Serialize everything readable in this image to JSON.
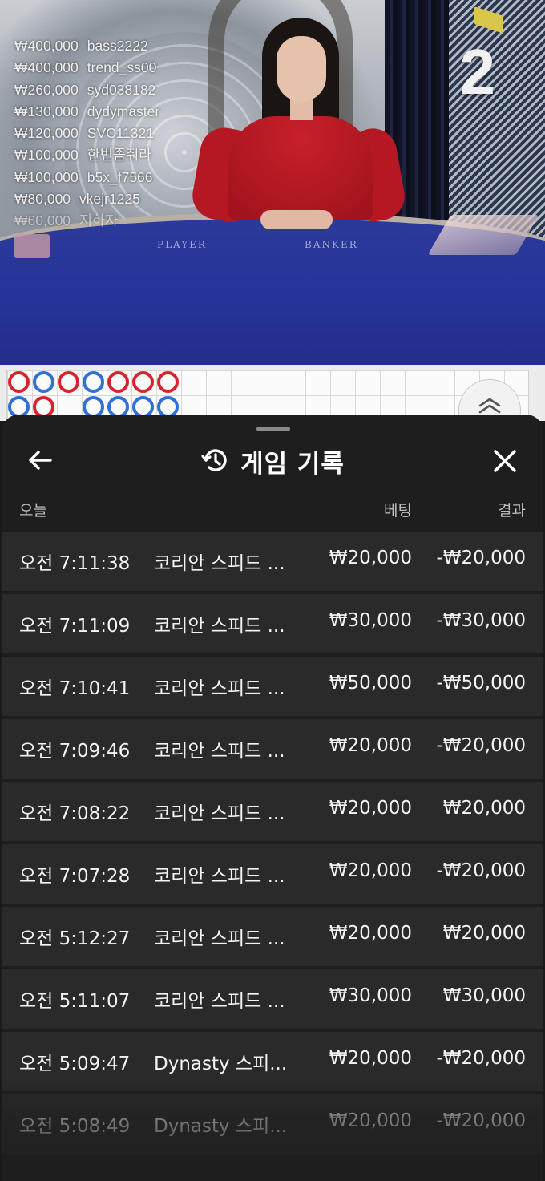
{
  "stream": {
    "table_labels": {
      "player": "PLAYER",
      "banker": "BANKER"
    },
    "round_number": "2",
    "winners": [
      {
        "amount": "₩400,000",
        "user": "bass2222"
      },
      {
        "amount": "₩400,000",
        "user": "trend_ss00"
      },
      {
        "amount": "₩260,000",
        "user": "syd038182"
      },
      {
        "amount": "₩130,000",
        "user": "dydymaster"
      },
      {
        "amount": "₩120,000",
        "user": "SVC11321"
      },
      {
        "amount": "₩100,000",
        "user": "한번좀줘라"
      },
      {
        "amount": "₩100,000",
        "user": "b5x_f7566"
      },
      {
        "amount": "₩80,000",
        "user": "vkejr1225"
      },
      {
        "amount": "₩60,000",
        "user": "지하자"
      }
    ]
  },
  "roadmap": {
    "beads": [
      "red",
      "blue",
      "blue",
      "red",
      "red",
      "blue",
      "blue",
      "red",
      "blue",
      "red",
      "blue",
      "red",
      "blue"
    ]
  },
  "history": {
    "title": "게임 기록",
    "icons": {
      "back": "arrow-left-icon",
      "title": "history-clock-icon",
      "close": "close-icon"
    },
    "columns": {
      "date": "오늘",
      "bet": "베팅",
      "result": "결과"
    },
    "rows": [
      {
        "time": "오전 7:11:38",
        "game": "코리안 스피드 ...",
        "bet": "₩20,000",
        "result": "-₩20,000"
      },
      {
        "time": "오전 7:11:09",
        "game": "코리안 스피드 ...",
        "bet": "₩30,000",
        "result": "-₩30,000"
      },
      {
        "time": "오전 7:10:41",
        "game": "코리안 스피드 ...",
        "bet": "₩50,000",
        "result": "-₩50,000"
      },
      {
        "time": "오전 7:09:46",
        "game": "코리안 스피드 ...",
        "bet": "₩20,000",
        "result": "-₩20,000"
      },
      {
        "time": "오전 7:08:22",
        "game": "코리안 스피드 ...",
        "bet": "₩20,000",
        "result": "₩20,000"
      },
      {
        "time": "오전 7:07:28",
        "game": "코리안 스피드 ...",
        "bet": "₩20,000",
        "result": "-₩20,000"
      },
      {
        "time": "오전 5:12:27",
        "game": "코리안 스피드 ...",
        "bet": "₩20,000",
        "result": "₩20,000"
      },
      {
        "time": "오전 5:11:07",
        "game": "코리안 스피드 ...",
        "bet": "₩30,000",
        "result": "₩30,000"
      },
      {
        "time": "오전 5:09:47",
        "game": "Dynasty 스피...",
        "bet": "₩20,000",
        "result": "-₩20,000"
      },
      {
        "time": "오전 5:08:49",
        "game": "Dynasty 스피...",
        "bet": "₩20,000",
        "result": "-₩20,000"
      }
    ]
  }
}
